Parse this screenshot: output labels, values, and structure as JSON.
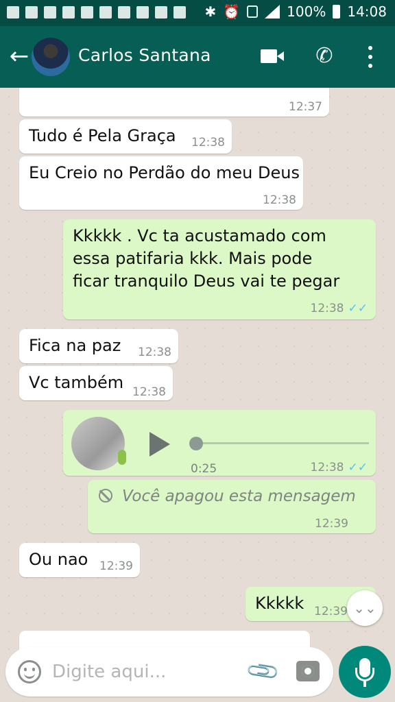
{
  "status_bar": {
    "battery": "100%",
    "time": "14:08",
    "left_icons": [
      "facebook-icon",
      "mail-icon",
      "image-icon",
      "notification-100-icon",
      "tools-icon",
      "newspaper-icon",
      "app-icon",
      "app-icon",
      "gmail-icon",
      "voicemail-icon"
    ]
  },
  "header": {
    "contact_name": "Carlos Santana",
    "back_icon": "←",
    "phone_icon": "✆"
  },
  "messages": [
    {
      "dir": "in",
      "text": "",
      "time": "12:37"
    },
    {
      "dir": "in",
      "text": "Tudo é Pela Graça",
      "time": "12:38"
    },
    {
      "dir": "in",
      "text": "Eu Creio no Perdão do meu Deus",
      "time": "12:38"
    },
    {
      "dir": "out",
      "lines": [
        "Kkkkk  . Vc ta acustamado com",
        "essa patifaria  kkk. Mais pode",
        "ficar tranquilo  Deus  vai te pegar"
      ],
      "time": "12:38",
      "ticks": "✓✓"
    },
    {
      "dir": "in",
      "text": "Fica na paz",
      "time": "12:38"
    },
    {
      "dir": "in",
      "text": "Vc também",
      "time": "12:38"
    },
    {
      "dir": "out",
      "type": "voice",
      "duration": "0:25",
      "time": "12:38",
      "ticks": "✓✓"
    },
    {
      "dir": "out",
      "type": "deleted",
      "text": "Você apagou esta mensagem",
      "time": "12:39"
    },
    {
      "dir": "in",
      "text": "Ou nao",
      "time": "12:39"
    },
    {
      "dir": "out",
      "text": "Kkkkk",
      "time": "12:39"
    }
  ],
  "scroll_down_icon": "⌄⌄",
  "composer": {
    "placeholder": "Digite aqui...",
    "attach_icon": "📎"
  },
  "colors": {
    "status_bar": "#054d44",
    "app_bar": "#075e54",
    "chat_bg": "#e5ddd5",
    "incoming": "#ffffff",
    "outgoing": "#dcf8c6",
    "read_ticks": "#4fc3f7",
    "mic_button": "#00897b"
  }
}
